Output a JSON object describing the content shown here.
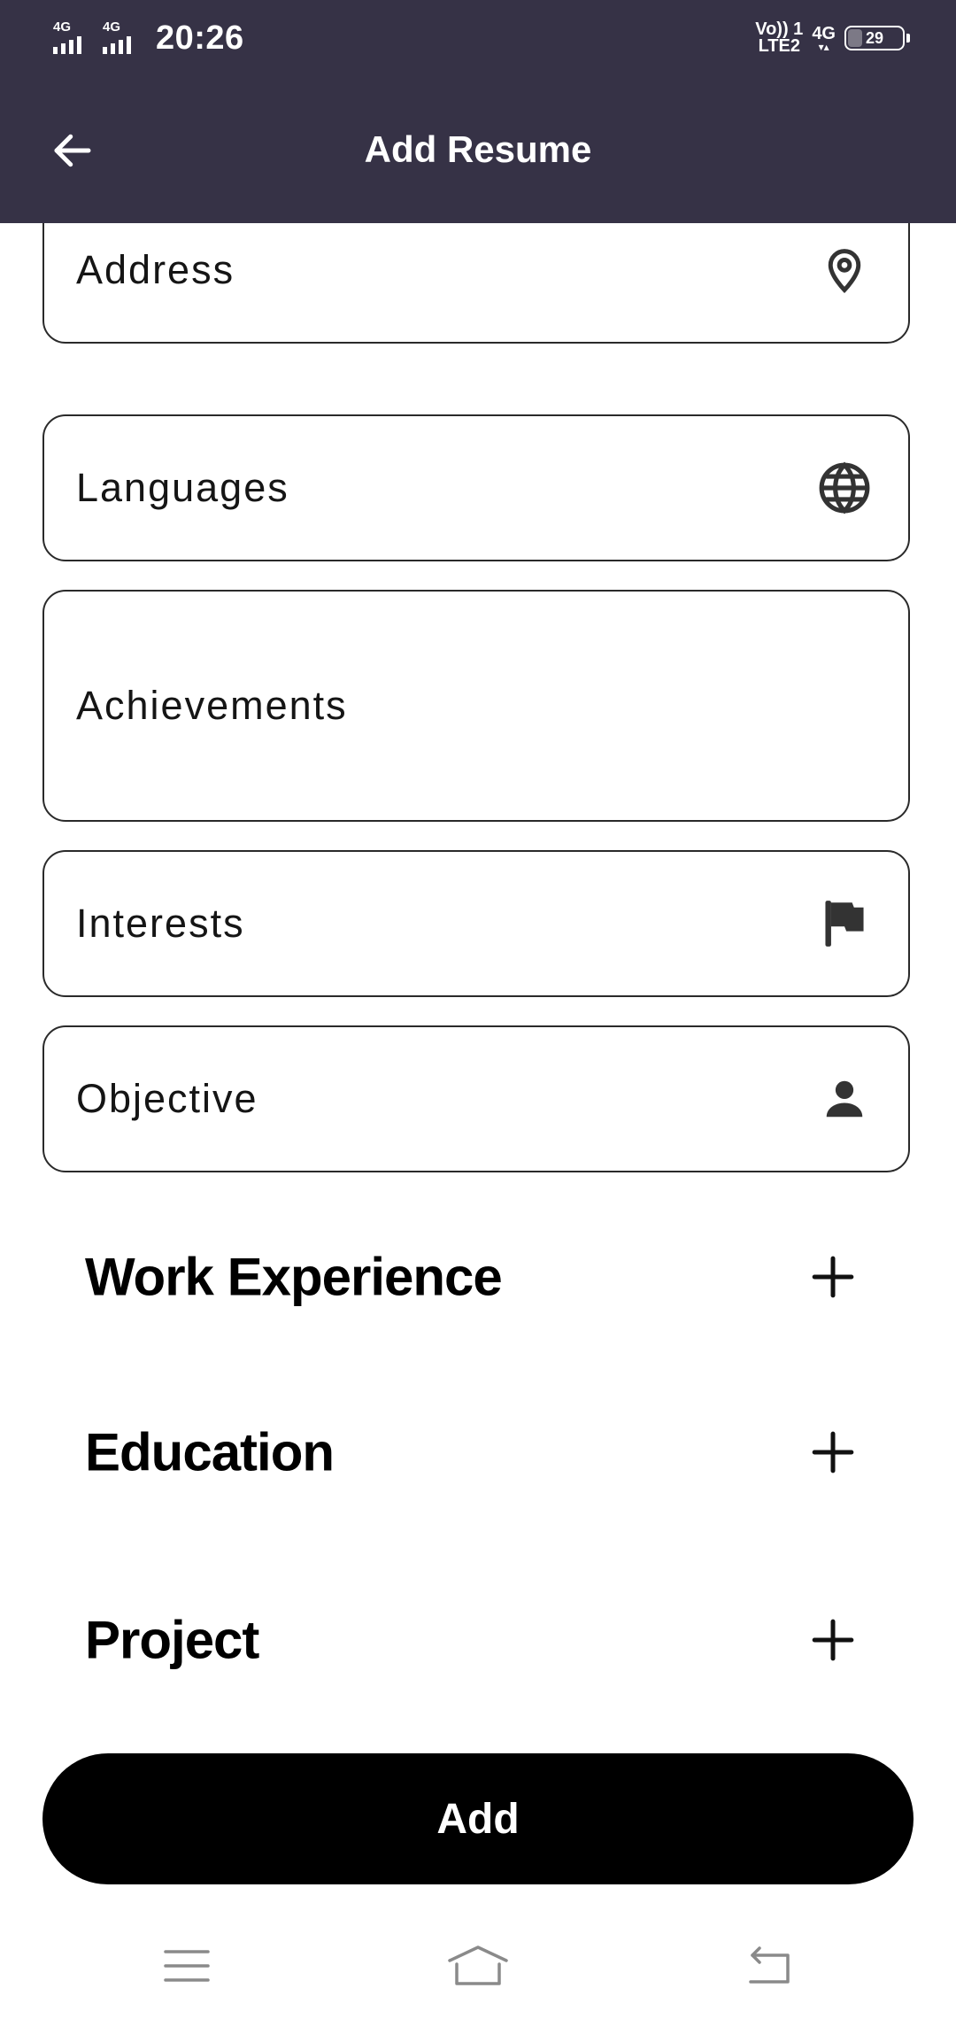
{
  "status_bar": {
    "sim1_network": "4G",
    "sim2_network": "4G",
    "time": "20:26",
    "volte_line1": "Vo)) 1",
    "volte_line2": "LTE2",
    "data_network": "4G",
    "battery_level": "29"
  },
  "app_bar": {
    "title": "Add Resume",
    "back_icon": "arrow-back-icon"
  },
  "fields": {
    "address": {
      "placeholder": "Address",
      "icon": "location-pin-icon"
    },
    "languages": {
      "placeholder": "Languages",
      "icon": "globe-icon"
    },
    "achievements": {
      "placeholder": "Achievements"
    },
    "interests": {
      "placeholder": "Interests",
      "icon": "flag-icon"
    },
    "objective": {
      "placeholder": "Objective",
      "icon": "person-icon"
    }
  },
  "sections": {
    "work_experience": {
      "title": "Work Experience",
      "icon": "plus-icon"
    },
    "education": {
      "title": "Education",
      "icon": "plus-icon"
    },
    "project": {
      "title": "Project",
      "icon": "plus-icon"
    }
  },
  "add_button": {
    "label": "Add"
  },
  "nav_bar": {
    "menu_icon": "menu-icon",
    "home_icon": "home-icon",
    "back_icon": "back-icon"
  },
  "colors": {
    "app_bar": "#363246",
    "button": "#000000",
    "field_border": "#2a2a2a"
  }
}
